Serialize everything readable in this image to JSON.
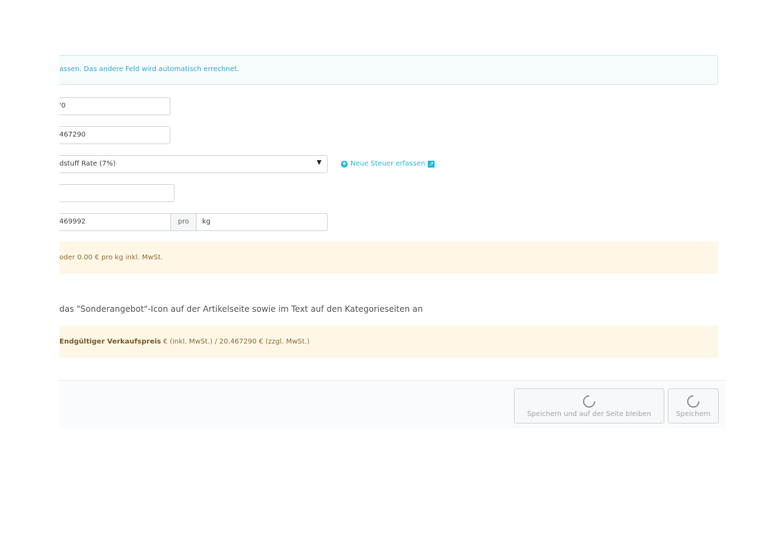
{
  "info": {
    "text": "assen. Das andere Feld wird automatisch errechnet."
  },
  "fields": {
    "price_excl": "'0",
    "price_incl": "467290",
    "tax_rule": "dstuff Rate (7%)",
    "empty_field": "",
    "unit_price": "469992",
    "unit_addon": "pro",
    "unit": "kg"
  },
  "tax_link": {
    "label": "Neue Steuer erfassen"
  },
  "warnings": {
    "unit_price_note": "oder 0.00 € pro kg inkl. MwSt.",
    "final_price_bold": "Endgültiger Verkaufspreis",
    "final_price_rest": " € (inkl. MwSt.) / 20.467290 € (zzgl. MwSt.)"
  },
  "special_offer": {
    "text": "das \"Sonderangebot\"-Icon auf der Artikelseite sowie im Text auf den Kategorieseiten an"
  },
  "footer": {
    "save_stay_label": "Speichern und auf der Seite bleiben",
    "save_label": "Speichern"
  },
  "colors": {
    "accent": "#25b9d7",
    "info_text": "#3aa7c9",
    "warning_bg": "#fff7e6",
    "warning_text": "#8a6d3b"
  }
}
